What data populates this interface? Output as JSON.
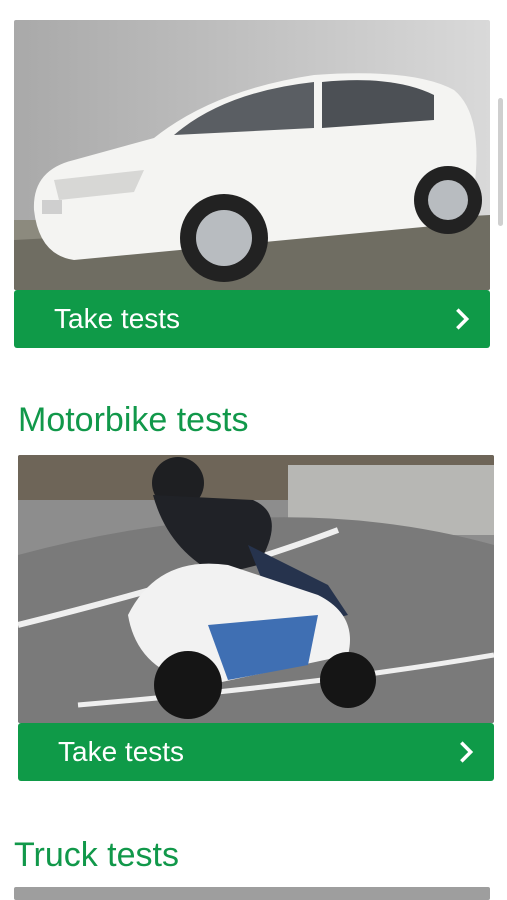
{
  "cards": [
    {
      "id": "car",
      "image_alt": "White hatchback car",
      "button_label": "Take tests"
    },
    {
      "id": "motorbike",
      "title": "Motorbike tests",
      "image_alt": "Rider on a sport motorbike cornering",
      "button_label": "Take tests"
    },
    {
      "id": "truck",
      "title": "Truck tests"
    }
  ],
  "colors": {
    "accent": "#0f9a48",
    "title": "#11984a"
  },
  "icons": {
    "chevron": "chevron-right-icon"
  }
}
